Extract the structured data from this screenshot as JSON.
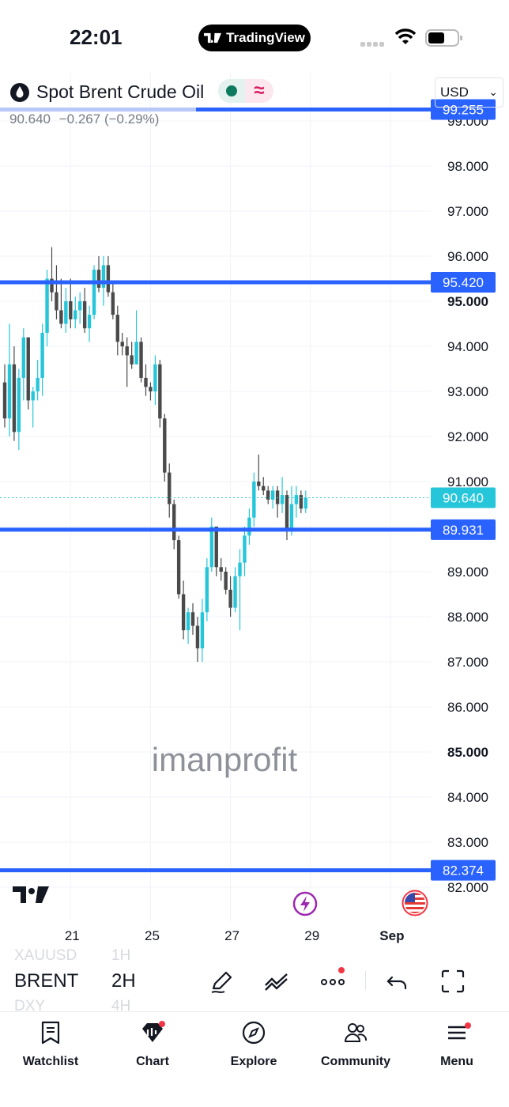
{
  "status_bar": {
    "time": "22:01",
    "app_pill": "TradingView"
  },
  "header": {
    "symbol_name": "Spot Brent Crude Oil",
    "currency": "USD"
  },
  "quote": {
    "last": "90.640",
    "change": "−0.267",
    "change_pct": "(−0.29%)"
  },
  "watermark": "imanprofit",
  "colors": {
    "up": "#26c6da",
    "down": "#4a4a4a",
    "hline": "#2962ff",
    "last_price": "#26c6da"
  },
  "chart_data": {
    "type": "candlestick",
    "y_ticks": [
      "82.000",
      "83.000",
      "84.000",
      "85.000",
      "86.000",
      "87.000",
      "88.000",
      "89.000",
      "90.000",
      "91.000",
      "92.000",
      "93.000",
      "94.000",
      "95.000",
      "96.000",
      "97.000",
      "98.000",
      "99.000"
    ],
    "y_bold_ticks": [
      "85.000",
      "95.000"
    ],
    "ylim": [
      81.7,
      99.4
    ],
    "x_ticks": [
      {
        "label": "21",
        "bar": 14
      },
      {
        "label": "25",
        "bar": 31
      },
      {
        "label": "27",
        "bar": 48
      },
      {
        "label": "29",
        "bar": 65
      },
      {
        "label": "Sep",
        "bar": 82
      }
    ],
    "horizontal_lines": [
      "99.255",
      "95.420",
      "89.931",
      "82.374"
    ],
    "last_price": "90.640",
    "candles": [
      [
        93.2,
        93.6,
        92.2,
        92.4
      ],
      [
        92.4,
        94.5,
        92.0,
        93.6
      ],
      [
        93.6,
        94.0,
        91.9,
        92.1
      ],
      [
        92.1,
        93.5,
        91.7,
        93.3
      ],
      [
        93.3,
        94.4,
        92.8,
        94.2
      ],
      [
        94.2,
        94.2,
        92.6,
        92.8
      ],
      [
        92.8,
        93.1,
        92.2,
        93.0
      ],
      [
        93.0,
        93.7,
        92.8,
        93.3
      ],
      [
        93.3,
        94.5,
        92.9,
        94.3
      ],
      [
        94.3,
        95.7,
        94.0,
        95.5
      ],
      [
        95.5,
        96.2,
        95.0,
        95.2
      ],
      [
        95.2,
        95.8,
        94.6,
        94.8
      ],
      [
        94.8,
        95.5,
        94.4,
        94.5
      ],
      [
        94.5,
        95.3,
        94.3,
        95.0
      ],
      [
        95.0,
        95.5,
        94.4,
        94.6
      ],
      [
        94.6,
        95.1,
        94.4,
        94.8
      ],
      [
        94.8,
        95.2,
        94.5,
        95.0
      ],
      [
        95.0,
        95.3,
        94.3,
        94.4
      ],
      [
        94.4,
        94.9,
        94.1,
        94.7
      ],
      [
        94.7,
        95.8,
        94.6,
        95.7
      ],
      [
        95.7,
        96.0,
        95.2,
        95.3
      ],
      [
        95.3,
        96.0,
        94.9,
        95.8
      ],
      [
        95.8,
        96.0,
        95.1,
        95.2
      ],
      [
        95.2,
        95.4,
        94.6,
        94.7
      ],
      [
        94.7,
        94.9,
        93.8,
        94.1
      ],
      [
        94.1,
        94.3,
        93.8,
        94.0
      ],
      [
        94.0,
        94.2,
        93.1,
        93.8
      ],
      [
        93.8,
        94.1,
        93.5,
        93.6
      ],
      [
        93.6,
        94.8,
        93.6,
        94.1
      ],
      [
        94.1,
        94.2,
        93.2,
        93.3
      ],
      [
        93.3,
        93.6,
        92.9,
        93.1
      ],
      [
        93.1,
        93.2,
        92.8,
        93.0
      ],
      [
        93.0,
        93.8,
        92.7,
        93.6
      ],
      [
        93.6,
        93.7,
        92.2,
        92.4
      ],
      [
        92.4,
        92.5,
        91.0,
        91.2
      ],
      [
        91.2,
        91.4,
        90.2,
        90.5
      ],
      [
        90.5,
        90.6,
        89.5,
        89.7
      ],
      [
        89.7,
        89.8,
        88.4,
        88.5
      ],
      [
        88.5,
        88.8,
        87.5,
        87.7
      ],
      [
        87.7,
        88.2,
        87.4,
        88.1
      ],
      [
        88.1,
        88.3,
        87.6,
        87.8
      ],
      [
        87.8,
        88.0,
        87.0,
        87.3
      ],
      [
        87.3,
        88.4,
        87.0,
        88.1
      ],
      [
        88.1,
        89.3,
        87.9,
        89.1
      ],
      [
        89.1,
        90.2,
        89.0,
        90.0
      ],
      [
        90.0,
        90.0,
        88.9,
        89.1
      ],
      [
        89.1,
        89.3,
        88.8,
        89.0
      ],
      [
        89.0,
        89.1,
        88.5,
        88.6
      ],
      [
        88.6,
        88.9,
        88.0,
        88.2
      ],
      [
        88.2,
        89.1,
        88.1,
        88.9
      ],
      [
        88.9,
        89.5,
        87.7,
        89.2
      ],
      [
        89.2,
        90.0,
        88.9,
        89.8
      ],
      [
        89.8,
        90.4,
        89.6,
        90.2
      ],
      [
        90.2,
        91.2,
        90.0,
        91.0
      ],
      [
        91.0,
        91.6,
        90.8,
        90.9
      ],
      [
        90.9,
        91.1,
        90.7,
        90.8
      ],
      [
        90.8,
        90.9,
        90.5,
        90.6
      ],
      [
        90.6,
        90.9,
        90.4,
        90.8
      ],
      [
        90.8,
        90.9,
        90.2,
        90.5
      ],
      [
        90.5,
        91.1,
        90.3,
        90.7
      ],
      [
        90.7,
        90.8,
        89.7,
        89.9
      ],
      [
        89.9,
        90.9,
        89.8,
        90.5
      ],
      [
        90.5,
        90.9,
        90.2,
        90.7
      ],
      [
        90.7,
        90.8,
        90.3,
        90.4
      ],
      [
        90.4,
        90.8,
        90.3,
        90.64
      ]
    ]
  },
  "toolbar": {
    "symbols": [
      "XAUUSD",
      "BRENT",
      "DXY"
    ],
    "intervals": [
      "1H",
      "2H",
      "4H"
    ]
  },
  "nav": [
    {
      "label": "Watchlist",
      "icon": "watchlist-icon"
    },
    {
      "label": "Chart",
      "icon": "chart-icon"
    },
    {
      "label": "Explore",
      "icon": "compass-icon"
    },
    {
      "label": "Community",
      "icon": "community-icon"
    },
    {
      "label": "Menu",
      "icon": "menu-icon"
    }
  ]
}
